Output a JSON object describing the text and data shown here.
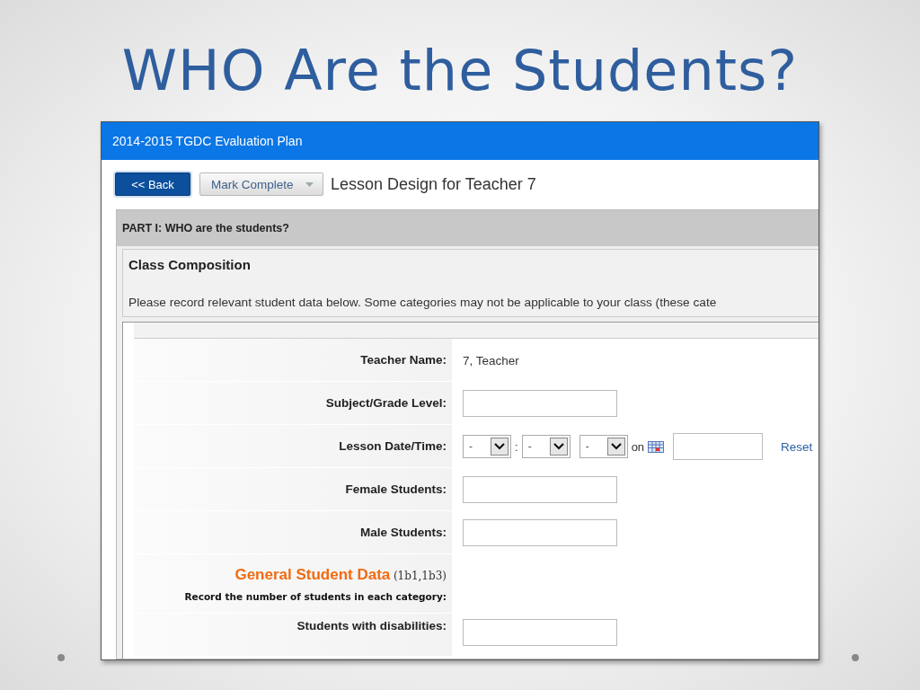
{
  "slide": {
    "title": "WHO Are the Students?"
  },
  "app": {
    "title": "2014-2015 TGDC Evaluation Plan",
    "back_button": "<< Back",
    "status_dropdown": "Mark Complete",
    "page_title": "Lesson Design for Teacher 7"
  },
  "section": {
    "title": "PART I: WHO are the students?",
    "subsection": "Class Composition",
    "note": "Please record relevant student data below. Some categories may not be applicable to your class (these cate"
  },
  "rows": [
    {
      "kind": "text",
      "label": "Teacher Name:",
      "value": "7, Teacher"
    },
    {
      "kind": "field",
      "label": "Subject/Grade Level:"
    },
    {
      "kind": "datetime",
      "label": "Lesson Date/Time:",
      "selects": [
        "-",
        "-",
        "-"
      ],
      "separator": ":",
      "on": "on",
      "link": "Reset"
    },
    {
      "kind": "field",
      "label": "Female Students:"
    },
    {
      "kind": "field",
      "label": "Male Students:"
    },
    {
      "kind": "heading",
      "title": "General Student Data",
      "code": "(1b1,1b3)",
      "instruction": "Record the number of students in each category:"
    },
    {
      "kind": "field",
      "label": "Students with disabilities:"
    }
  ]
}
